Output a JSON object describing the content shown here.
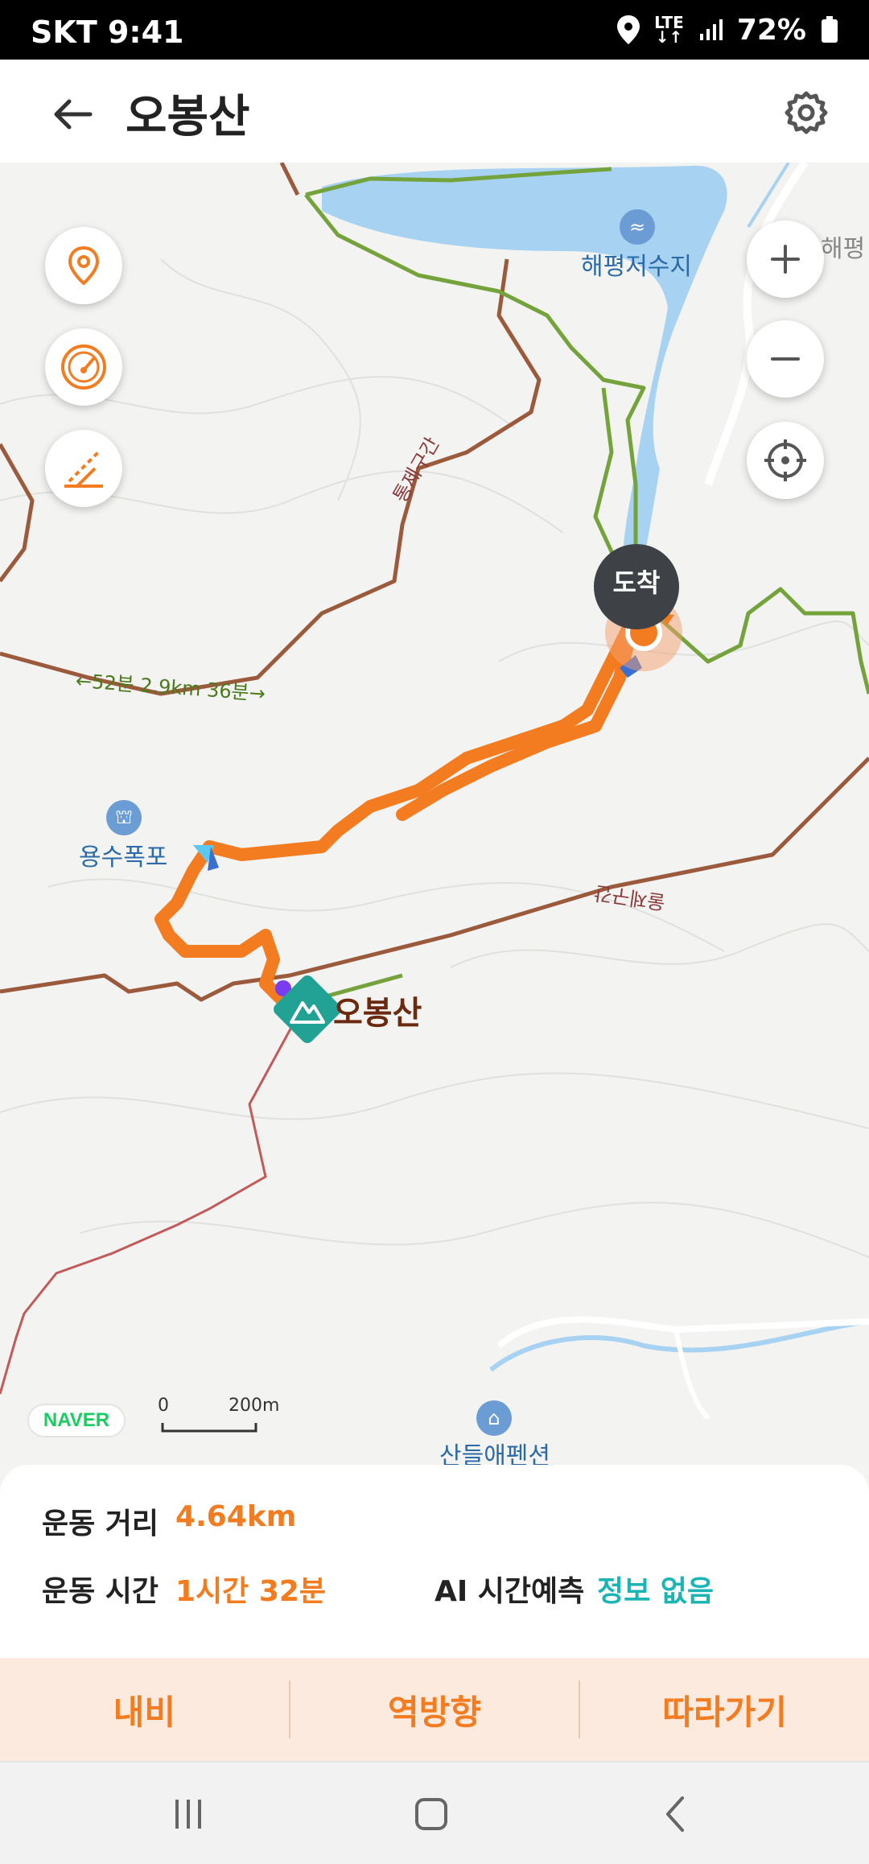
{
  "status_bar": {
    "carrier_time": "SKT 9:41",
    "network": "LTE",
    "battery": "72%",
    "icons": [
      "location-icon",
      "lte-icon",
      "signal-icon",
      "battery-icon"
    ]
  },
  "header": {
    "title": "오봉산",
    "back_icon": "arrow-left-icon",
    "settings_icon": "gear-icon"
  },
  "map": {
    "left_controls": [
      "location-pin-icon",
      "speedometer-icon",
      "slope-icon"
    ],
    "right_controls": [
      "zoom-in-icon",
      "zoom-out-icon",
      "crosshair-icon"
    ],
    "labels": {
      "reservoir": "해평저수지",
      "village": "해평",
      "waterfall": "용수폭포",
      "pension": "산들애펜션",
      "peak": "오봉산",
      "arrival": "도착",
      "trail_a": "통제구간",
      "trail_b": "울제구간",
      "segment": "←52분 2.9km 36분→"
    },
    "attribution": "NAVER",
    "scale": {
      "zero": "0",
      "distance": "200m"
    },
    "colors": {
      "route": "#f47c20",
      "trail": "#9b5a3c",
      "green_trail": "#74a33c",
      "water": "#a7d2f2",
      "peak_marker": "#22a295"
    }
  },
  "stats": {
    "distance_label": "운동 거리",
    "distance_value": "4.64km",
    "time_label": "운동 시간",
    "time_value": "1시간 32분",
    "ai_label": "AI 시간예측",
    "ai_value": "정보 없음"
  },
  "actions": {
    "navi": "내비",
    "reverse": "역방향",
    "follow": "따라가기"
  },
  "nav_bar": [
    "recents-icon",
    "home-icon",
    "back-icon"
  ]
}
